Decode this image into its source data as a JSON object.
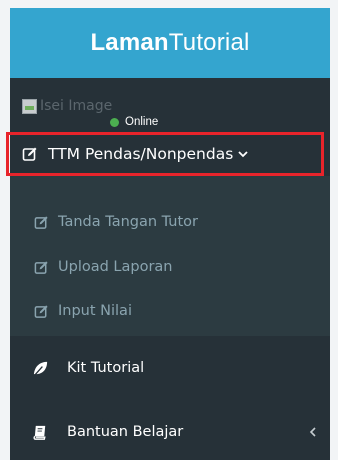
{
  "brand": {
    "bold": "Laman",
    "light": "Tutorial"
  },
  "user": {
    "image_alt": "Isei Image",
    "status": "Online"
  },
  "menu": {
    "active": {
      "label": "TTM Pendas/Nonpendas"
    },
    "submenu": [
      {
        "label": "Tanda Tangan Tutor"
      },
      {
        "label": "Upload Laporan"
      },
      {
        "label": "Input Nilai"
      }
    ],
    "items": [
      {
        "label": "Kit Tutorial",
        "icon": "leaf-icon"
      },
      {
        "label": "Bantuan Belajar",
        "icon": "book-icon"
      }
    ]
  },
  "colors": {
    "header": "#34a5cf",
    "sidebar": "#263138",
    "submenu": "#2c3b41",
    "highlight": "#e8242b",
    "online": "#4caf50"
  }
}
